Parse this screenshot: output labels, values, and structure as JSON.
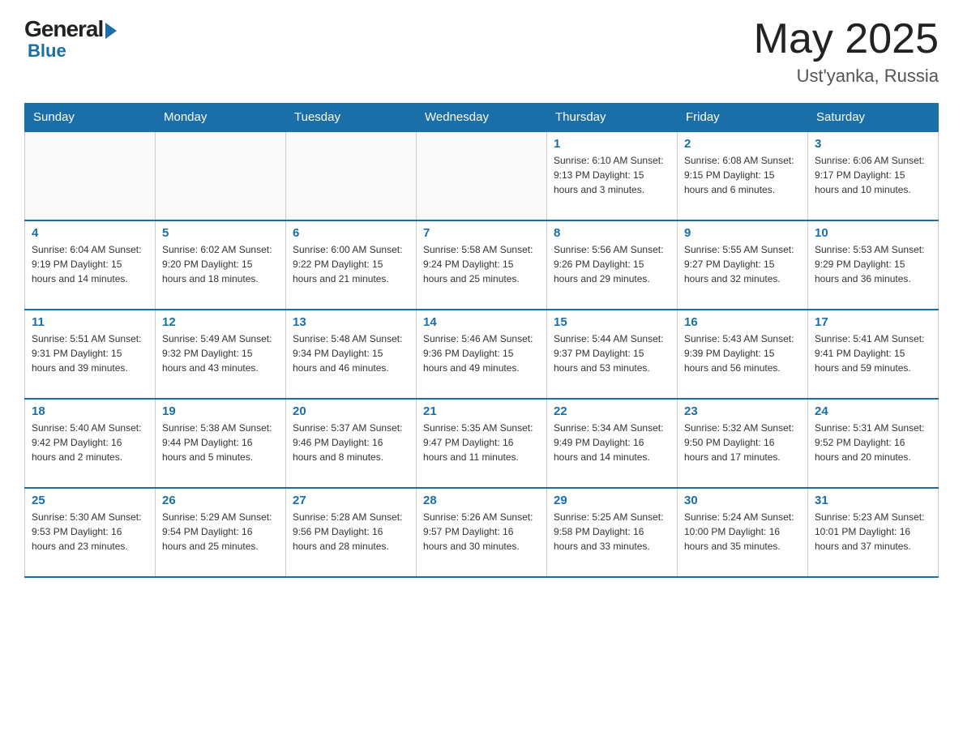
{
  "header": {
    "logo_general": "General",
    "logo_blue": "Blue",
    "title": "May 2025",
    "location": "Ust'yanka, Russia"
  },
  "days_of_week": [
    "Sunday",
    "Monday",
    "Tuesday",
    "Wednesday",
    "Thursday",
    "Friday",
    "Saturday"
  ],
  "weeks": [
    [
      {
        "day": "",
        "info": ""
      },
      {
        "day": "",
        "info": ""
      },
      {
        "day": "",
        "info": ""
      },
      {
        "day": "",
        "info": ""
      },
      {
        "day": "1",
        "info": "Sunrise: 6:10 AM\nSunset: 9:13 PM\nDaylight: 15 hours\nand 3 minutes."
      },
      {
        "day": "2",
        "info": "Sunrise: 6:08 AM\nSunset: 9:15 PM\nDaylight: 15 hours\nand 6 minutes."
      },
      {
        "day": "3",
        "info": "Sunrise: 6:06 AM\nSunset: 9:17 PM\nDaylight: 15 hours\nand 10 minutes."
      }
    ],
    [
      {
        "day": "4",
        "info": "Sunrise: 6:04 AM\nSunset: 9:19 PM\nDaylight: 15 hours\nand 14 minutes."
      },
      {
        "day": "5",
        "info": "Sunrise: 6:02 AM\nSunset: 9:20 PM\nDaylight: 15 hours\nand 18 minutes."
      },
      {
        "day": "6",
        "info": "Sunrise: 6:00 AM\nSunset: 9:22 PM\nDaylight: 15 hours\nand 21 minutes."
      },
      {
        "day": "7",
        "info": "Sunrise: 5:58 AM\nSunset: 9:24 PM\nDaylight: 15 hours\nand 25 minutes."
      },
      {
        "day": "8",
        "info": "Sunrise: 5:56 AM\nSunset: 9:26 PM\nDaylight: 15 hours\nand 29 minutes."
      },
      {
        "day": "9",
        "info": "Sunrise: 5:55 AM\nSunset: 9:27 PM\nDaylight: 15 hours\nand 32 minutes."
      },
      {
        "day": "10",
        "info": "Sunrise: 5:53 AM\nSunset: 9:29 PM\nDaylight: 15 hours\nand 36 minutes."
      }
    ],
    [
      {
        "day": "11",
        "info": "Sunrise: 5:51 AM\nSunset: 9:31 PM\nDaylight: 15 hours\nand 39 minutes."
      },
      {
        "day": "12",
        "info": "Sunrise: 5:49 AM\nSunset: 9:32 PM\nDaylight: 15 hours\nand 43 minutes."
      },
      {
        "day": "13",
        "info": "Sunrise: 5:48 AM\nSunset: 9:34 PM\nDaylight: 15 hours\nand 46 minutes."
      },
      {
        "day": "14",
        "info": "Sunrise: 5:46 AM\nSunset: 9:36 PM\nDaylight: 15 hours\nand 49 minutes."
      },
      {
        "day": "15",
        "info": "Sunrise: 5:44 AM\nSunset: 9:37 PM\nDaylight: 15 hours\nand 53 minutes."
      },
      {
        "day": "16",
        "info": "Sunrise: 5:43 AM\nSunset: 9:39 PM\nDaylight: 15 hours\nand 56 minutes."
      },
      {
        "day": "17",
        "info": "Sunrise: 5:41 AM\nSunset: 9:41 PM\nDaylight: 15 hours\nand 59 minutes."
      }
    ],
    [
      {
        "day": "18",
        "info": "Sunrise: 5:40 AM\nSunset: 9:42 PM\nDaylight: 16 hours\nand 2 minutes."
      },
      {
        "day": "19",
        "info": "Sunrise: 5:38 AM\nSunset: 9:44 PM\nDaylight: 16 hours\nand 5 minutes."
      },
      {
        "day": "20",
        "info": "Sunrise: 5:37 AM\nSunset: 9:46 PM\nDaylight: 16 hours\nand 8 minutes."
      },
      {
        "day": "21",
        "info": "Sunrise: 5:35 AM\nSunset: 9:47 PM\nDaylight: 16 hours\nand 11 minutes."
      },
      {
        "day": "22",
        "info": "Sunrise: 5:34 AM\nSunset: 9:49 PM\nDaylight: 16 hours\nand 14 minutes."
      },
      {
        "day": "23",
        "info": "Sunrise: 5:32 AM\nSunset: 9:50 PM\nDaylight: 16 hours\nand 17 minutes."
      },
      {
        "day": "24",
        "info": "Sunrise: 5:31 AM\nSunset: 9:52 PM\nDaylight: 16 hours\nand 20 minutes."
      }
    ],
    [
      {
        "day": "25",
        "info": "Sunrise: 5:30 AM\nSunset: 9:53 PM\nDaylight: 16 hours\nand 23 minutes."
      },
      {
        "day": "26",
        "info": "Sunrise: 5:29 AM\nSunset: 9:54 PM\nDaylight: 16 hours\nand 25 minutes."
      },
      {
        "day": "27",
        "info": "Sunrise: 5:28 AM\nSunset: 9:56 PM\nDaylight: 16 hours\nand 28 minutes."
      },
      {
        "day": "28",
        "info": "Sunrise: 5:26 AM\nSunset: 9:57 PM\nDaylight: 16 hours\nand 30 minutes."
      },
      {
        "day": "29",
        "info": "Sunrise: 5:25 AM\nSunset: 9:58 PM\nDaylight: 16 hours\nand 33 minutes."
      },
      {
        "day": "30",
        "info": "Sunrise: 5:24 AM\nSunset: 10:00 PM\nDaylight: 16 hours\nand 35 minutes."
      },
      {
        "day": "31",
        "info": "Sunrise: 5:23 AM\nSunset: 10:01 PM\nDaylight: 16 hours\nand 37 minutes."
      }
    ]
  ]
}
